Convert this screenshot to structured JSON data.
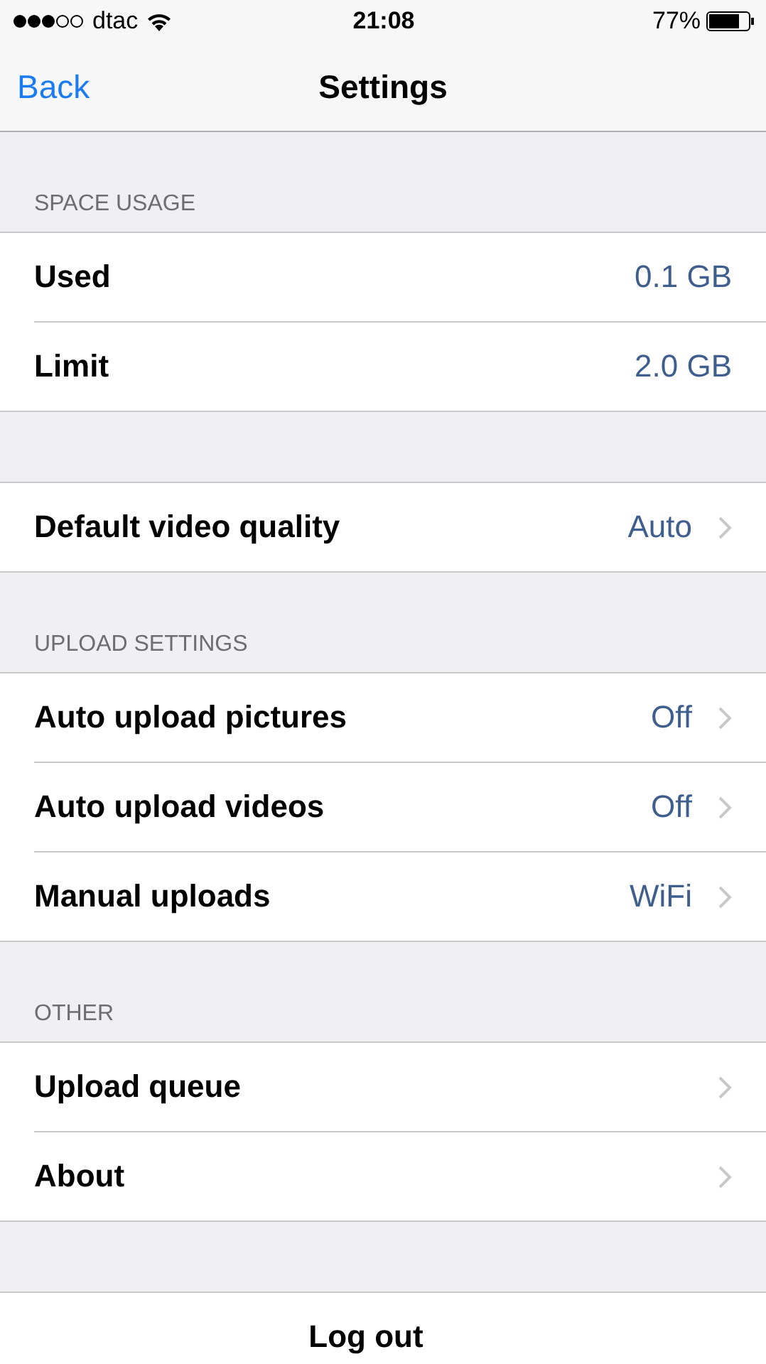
{
  "status_bar": {
    "carrier": "dtac",
    "time": "21:08",
    "battery": "77%"
  },
  "nav_bar": {
    "back": "Back",
    "title": "Settings"
  },
  "sections": [
    {
      "header": "SPACE USAGE",
      "rows": [
        {
          "kind": "info",
          "label": "Used",
          "value": "0.1 GB"
        },
        {
          "kind": "info",
          "label": "Limit",
          "value": "2.0 GB"
        }
      ]
    },
    {
      "rows": [
        {
          "kind": "link",
          "label": "Default video quality",
          "value": "Auto"
        }
      ]
    },
    {
      "header": "UPLOAD SETTINGS",
      "rows": [
        {
          "kind": "link",
          "label": "Auto upload pictures",
          "value": "Off"
        },
        {
          "kind": "link",
          "label": "Auto upload videos",
          "value": "Off"
        },
        {
          "kind": "link",
          "label": "Manual uploads",
          "value": "WiFi"
        }
      ]
    },
    {
      "header": "OTHER",
      "rows": [
        {
          "kind": "link",
          "label": "Upload queue"
        },
        {
          "kind": "link",
          "label": "About"
        }
      ]
    },
    {
      "rows": [
        {
          "kind": "action",
          "label": "Log out"
        }
      ]
    }
  ]
}
